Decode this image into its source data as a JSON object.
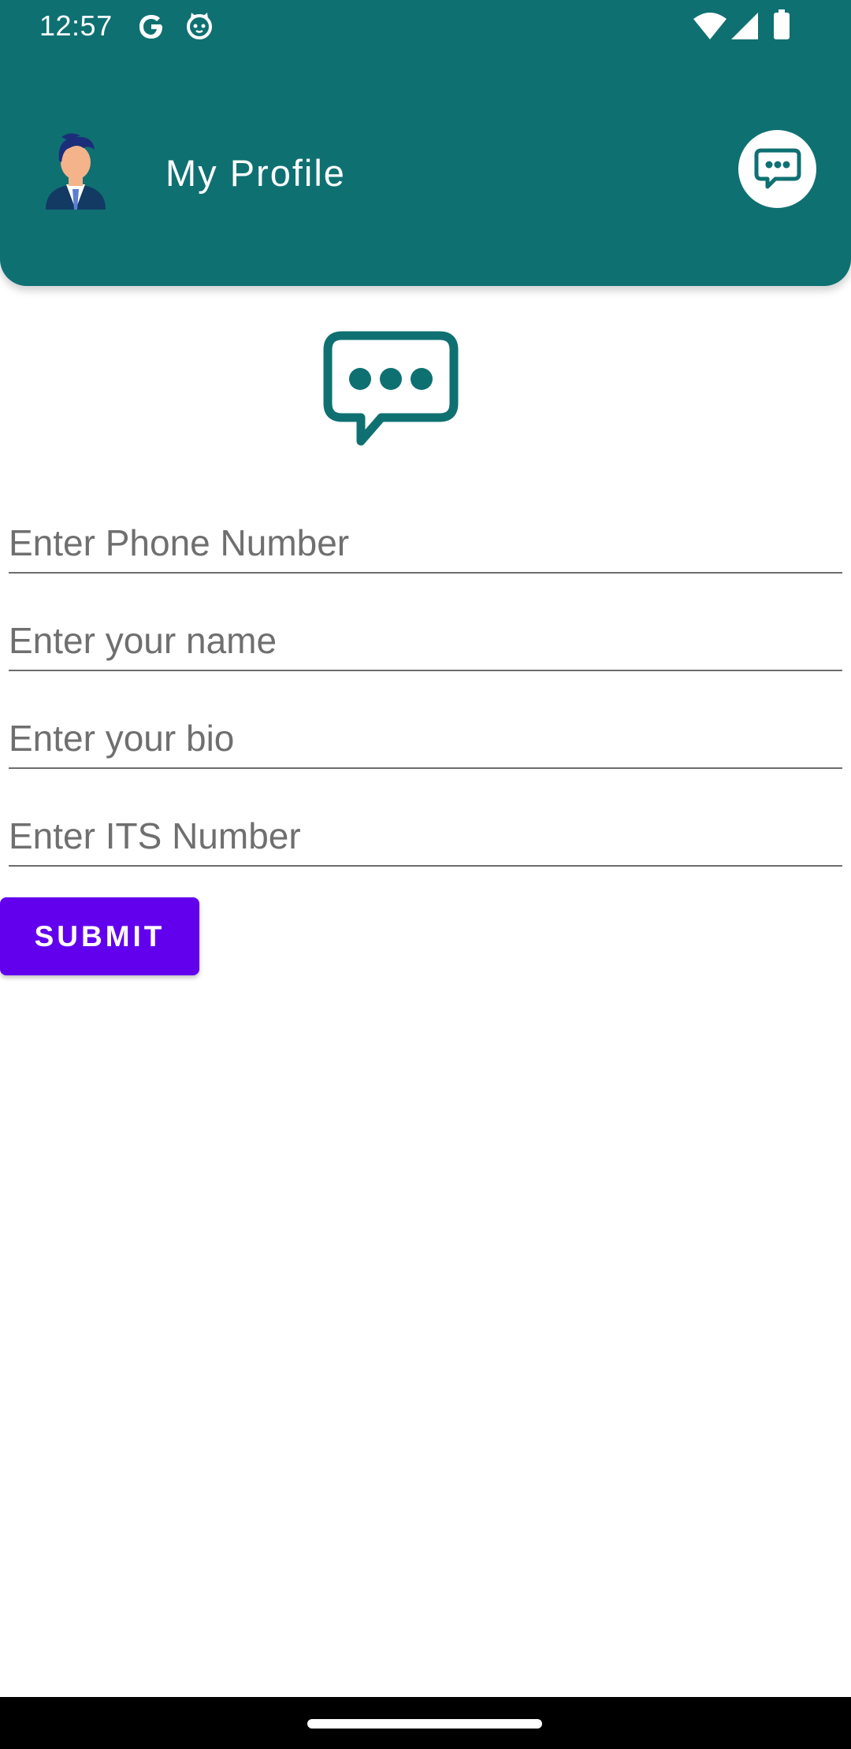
{
  "status_bar": {
    "time": "12:57",
    "icons": [
      "google-g-icon",
      "cat-face-icon",
      "wifi-icon",
      "cell-signal-icon",
      "battery-icon"
    ]
  },
  "header": {
    "title": "My Profile",
    "avatar_icon": "user-avatar-icon",
    "action_icon": "chat-bubble-icon"
  },
  "logo": {
    "icon": "chat-bubble-dots-icon"
  },
  "form": {
    "phone_placeholder": "Enter Phone Number",
    "name_placeholder": "Enter your name",
    "bio_placeholder": "Enter your bio",
    "its_placeholder": "Enter ITS Number",
    "submit_label": "SUBMIT"
  },
  "colors": {
    "header": "#0f7072",
    "accent": "#6200ee",
    "background": "#ffffff"
  }
}
